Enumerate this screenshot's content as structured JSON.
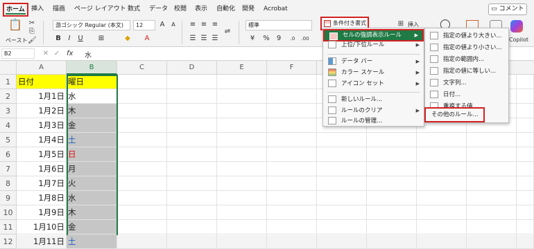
{
  "tabs": [
    "ホーム",
    "挿入",
    "描画",
    "ページ レイアウト",
    "数式",
    "データ",
    "校閲",
    "表示",
    "自動化",
    "開発",
    "Acrobat"
  ],
  "comment_label": "コメント",
  "ribbon": {
    "paste_label": "ペースト",
    "font_name": "游ゴシック Regular (本文)",
    "font_size": "12",
    "number_format": "標準",
    "cf_label": "条件付き書式",
    "insert_label": "挿入",
    "copilot_label": "Copilot"
  },
  "formula_bar": {
    "cell_ref": "B2",
    "fx": "fx",
    "value": "水"
  },
  "columns": [
    "A",
    "B",
    "C",
    "D",
    "E",
    "F"
  ],
  "rows": [
    {
      "num": "1",
      "a": "日付",
      "b": "曜日",
      "b_color": ""
    },
    {
      "num": "2",
      "a": "1月1日",
      "b": "水",
      "b_color": ""
    },
    {
      "num": "3",
      "a": "1月2日",
      "b": "木",
      "b_color": ""
    },
    {
      "num": "4",
      "a": "1月3日",
      "b": "金",
      "b_color": ""
    },
    {
      "num": "5",
      "a": "1月4日",
      "b": "土",
      "b_color": "#1f5fc2"
    },
    {
      "num": "6",
      "a": "1月5日",
      "b": "日",
      "b_color": "#e01010"
    },
    {
      "num": "7",
      "a": "1月6日",
      "b": "月",
      "b_color": ""
    },
    {
      "num": "8",
      "a": "1月7日",
      "b": "火",
      "b_color": ""
    },
    {
      "num": "9",
      "a": "1月8日",
      "b": "水",
      "b_color": ""
    },
    {
      "num": "10",
      "a": "1月9日",
      "b": "木",
      "b_color": ""
    },
    {
      "num": "11",
      "a": "1月10日",
      "b": "金",
      "b_color": ""
    },
    {
      "num": "12",
      "a": "1月11日",
      "b": "土",
      "b_color": "#1f5fc2"
    }
  ],
  "cf_menu": {
    "items": [
      "セルの強調表示ルール",
      "上位/下位ルール",
      "データ バー",
      "カラー スケール",
      "アイコン セット",
      "新しいルール...",
      "ルールのクリア",
      "ルールの管理..."
    ]
  },
  "sub_menu": {
    "items": [
      "指定の値より大きい...",
      "指定の値より小さい...",
      "指定の範囲内...",
      "指定の値に等しい...",
      "文字列...",
      "日付...",
      "重複する値...",
      "その他のルール..."
    ]
  },
  "colors": {
    "accent": "#1f7a44",
    "highlight_border": "#d42020",
    "header_fill": "#ffff00"
  }
}
